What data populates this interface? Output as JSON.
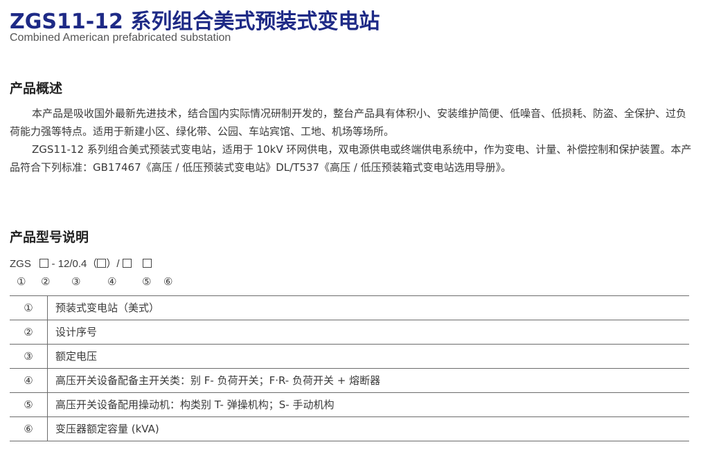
{
  "header": {
    "title": "ZGS11-12 系列组合美式预装式变电站",
    "subtitle": "Combined American prefabricated substation"
  },
  "overview": {
    "heading": "产品概述",
    "paragraphs": [
      "本产品是吸收国外最新先进技术，结合国内实际情况研制开发的，整台产品具有体积小、安装维护简便、低噪音、低损耗、防盗、全保护、过负荷能力强等特点。适用于新建小区、绿化带、公园、车站宾馆、工地、机场等场所。",
      "ZGS11-12 系列组合美式预装式变电站，适用于 10kV 环网供电，双电源供电或终端供电系统中，作为变电、计量、补偿控制和保护装置。本产品符合下列标准：GB17467《高压 / 低压预装式变电站》DL/T537《高压 / 低压预装箱式变电站选用导册》。"
    ]
  },
  "model": {
    "heading": "产品型号说明",
    "code": {
      "prefix": "ZGS",
      "part2": "- 12/0.4（",
      "part3": "）/"
    },
    "markers": [
      "①",
      "②",
      "③",
      "④",
      "⑤",
      "⑥"
    ],
    "rows": [
      {
        "num": "①",
        "desc": "预装式变电站（美式）"
      },
      {
        "num": "②",
        "desc": "设计序号"
      },
      {
        "num": "③",
        "desc": "额定电压"
      },
      {
        "num": "④",
        "desc": "高压开关设备配备主开关类：别 F- 负荷开关；F·R- 负荷开关 + 熔断器"
      },
      {
        "num": "⑤",
        "desc": "高压开关设备配用操动机：构类别 T- 弹操机构；S- 手动机构"
      },
      {
        "num": "⑥",
        "desc": "变压器额定容量 (kVA)"
      }
    ]
  }
}
